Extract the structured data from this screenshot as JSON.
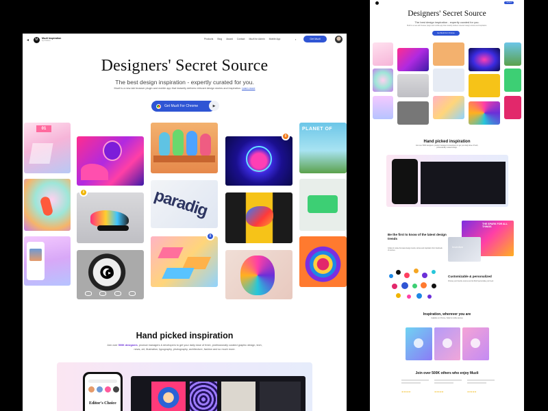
{
  "main": {
    "nav": {
      "back": "◂",
      "logo_letter": "M",
      "logo_title": "Muzli Inspiration",
      "logo_sub": "by InVision",
      "links": [
        "Products",
        "Blog",
        "Award",
        "Contact",
        "Muzli for Admin",
        "Mobile App"
      ],
      "cta": "Get Muzli"
    },
    "hero": {
      "title": "Designers' Secret Source",
      "subtitle": "The best design inspiration - expertly curated for you.",
      "desc": "Muzli is a new-tab browser plugin and mobile app that instantly delivers relevant design stories and inspiration.",
      "learn_more": "Learn more",
      "cta": "Get Muzli For Chrome"
    },
    "tiles": {
      "badge_1": "8",
      "badge_2": "8",
      "badge_3": "8",
      "tile_numbers": "01",
      "planet": "PLANET OF",
      "paradigm": "paradig"
    },
    "hand_picked": {
      "title": "Hand picked inspiration",
      "desc_prefix": "Join over ",
      "desc_bold": "500K designers",
      "desc_rest": ", product managers & developers to get your daily dose of fresh, professionally curated graphic design, tech, news, art, illustration, typography, photography, architecture, fashion and so much more.",
      "editors_choice": "Editor's Choice"
    }
  },
  "right": {
    "title": "Designers' Secret Source",
    "subtitle": "The best design inspiration - expertly curated for you.",
    "desc": "Muzli is a new-tab browser plugin and mobile app that instantly delivers relevant design stories and inspiration.",
    "cta": "Get Muzli For Chrome",
    "get_btn": "Get Muzli",
    "hand_picked": "Hand picked inspiration",
    "hp_desc": "Join over 500K designers, product managers & developers to get your daily dose of fresh, professionally curated design.",
    "first_to_know": "Be the first to know of the latest design trends",
    "first_desc": "Collect & curate the latest design trends, stories and inspiration from hundreds of sources.",
    "customizable": "Customizable & personalized",
    "cust_desc": "Choose your favorite sources and let Muzli personalise your feed.",
    "wherever": "Inspiration, wherever you are",
    "wherever_desc": "Available on Chrome, Safari & mobile devices",
    "join": "Join over 500K others who enjoy Muzli",
    "card_label": "Inventive",
    "spark": "THE SPARK FOR ALL THINGS"
  },
  "colors": {
    "accent": "#2f55d4",
    "purple_bold": "#6b2fd8",
    "badge_orange": "#f07a1a",
    "badge_yellow": "#f0b400",
    "badge_blue": "#2f55d4"
  }
}
